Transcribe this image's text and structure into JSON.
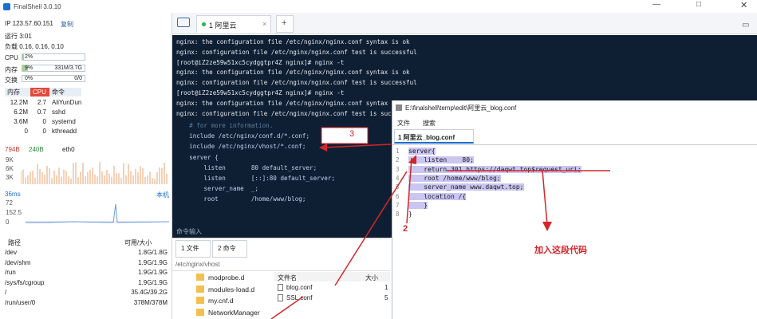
{
  "app": {
    "title": "FinalShell 3.0.10"
  },
  "left": {
    "ip_label": "IP 123.57.60.151",
    "copy_label": "复制",
    "uptime": "运行 3:01",
    "load": "负载 0.16, 0.16, 0.10",
    "cpu_label": "CPU",
    "cpu_value": "2%",
    "cpu_fraction": 0.02,
    "mem_label": "内存",
    "mem_percent": "9%",
    "mem_value": "331M/3.7G",
    "mem_fraction": 0.09,
    "swap_label": "交换",
    "swap_percent": "0%",
    "swap_value": "0/0",
    "proc_headers": [
      "内存",
      "CPU",
      "命令"
    ],
    "processes": [
      {
        "mem": "12.2M",
        "cpu": "2.7",
        "cmd": "AliYunDun"
      },
      {
        "mem": "6.2M",
        "cpu": "0.7",
        "cmd": "sshd"
      },
      {
        "mem": "3.6M",
        "cpu": "0",
        "cmd": "systemd"
      },
      {
        "mem": "0",
        "cpu": "0",
        "cmd": "kthreadd"
      }
    ],
    "net_up": "794B",
    "net_down": "240B",
    "net_if": "eth0",
    "net_ticks": [
      "9K",
      "6K",
      "3K"
    ],
    "latency_label": "36ms",
    "latency_host": "本机",
    "latency_ticks": [
      "72",
      "152.5",
      "0"
    ],
    "disk_headers": [
      "路径",
      "可用/大小"
    ],
    "disks": [
      {
        "path": "/dev",
        "size": "1.8G/1.8G"
      },
      {
        "path": "/dev/shm",
        "size": "1.9G/1.9G"
      },
      {
        "path": "/run",
        "size": "1.9G/1.9G"
      },
      {
        "path": "/sys/fs/cgroup",
        "size": "1.9G/1.9G"
      },
      {
        "path": "/",
        "size": "35.4G/39.2G"
      },
      {
        "path": "/run/user/0",
        "size": "378M/378M"
      }
    ]
  },
  "tabs": {
    "session": "1 阿里云"
  },
  "terminal": {
    "lines": [
      "nginx: the configuration file /etc/nginx/nginx.conf syntax is ok",
      "nginx: configuration file /etc/nginx/nginx.conf test is successful",
      "[root@iZ2ze59w51xc5cydggtpr4Z nginx]# nginx -t",
      "nginx: the configuration file /etc/nginx/nginx.conf syntax is ok",
      "nginx: configuration file /etc/nginx/nginx.conf test is successful",
      "[root@iZ2ze59w51xc5cydggtpr4Z nginx]# nginx -t",
      "nginx: the configuration file /etc/nginx/nginx.conf syntax is ok",
      "nginx: configuration file /etc/nginx/nginx.conf test is successful"
    ],
    "code": [
      "  # for more information.",
      "  include /etc/nginx/conf.d/*.conf;",
      "  include /etc/nginx/vhost/*.conf;",
      "  server {",
      "      listen       80 default_server;",
      "      listen       [::]:80 default_server;",
      "      server_name  _;",
      "      root         /home/www/blog;"
    ],
    "cmd_placeholder": "命令输入"
  },
  "files": {
    "tab1": "1 文件",
    "tab2": "2 命令",
    "path": "/etc/nginx/vhost",
    "tree": [
      "modprobe.d",
      "modules-load.d",
      "my.cnf.d",
      "NetworkManager"
    ],
    "col_name": "文件名",
    "col_size": "大小",
    "list": [
      {
        "name": "blog.conf",
        "size": "1"
      },
      {
        "name": "SSL.conf",
        "size": "5"
      }
    ]
  },
  "editor": {
    "path": "E:\\finalshell\\temp\\edit\\阿里云_blog.conf",
    "menu_file": "文件",
    "menu_search": "搜索",
    "tab": "1 阿里云_blog.conf",
    "lines": [
      "server{",
      "    listen    80;",
      "    return 301 https://daqwt.top$request_uri;",
      "    root /home/www/blog;",
      "    server_name www.daqwt.top;",
      "    location /{",
      "    }",
      "}"
    ],
    "line_numbers": [
      "1",
      "2",
      "3",
      "4",
      "5",
      "6",
      "7",
      "8"
    ]
  },
  "annotations": {
    "num2": "2",
    "num3": "3",
    "note": "加入这段代码"
  },
  "colors": {
    "accent": "#1c6fd1",
    "terminal_bg": "#0f1f33",
    "annotation": "#d3262a",
    "highlight": "#c9c6f1"
  }
}
